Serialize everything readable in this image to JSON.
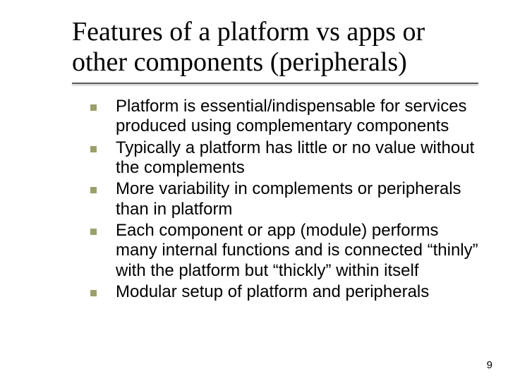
{
  "title": "Features of a platform vs apps or other components (peripherals)",
  "bullets": [
    "Platform is essential/indispensable for services produced using complementary components",
    "Typically a platform has little or no value without the complements",
    "More variability in complements or peripherals than in platform",
    "Each component or app (module) performs many internal functions and is connected “thinly” with the platform but “thickly” within itself",
    "Modular setup of platform and peripherals"
  ],
  "page_number": "9"
}
